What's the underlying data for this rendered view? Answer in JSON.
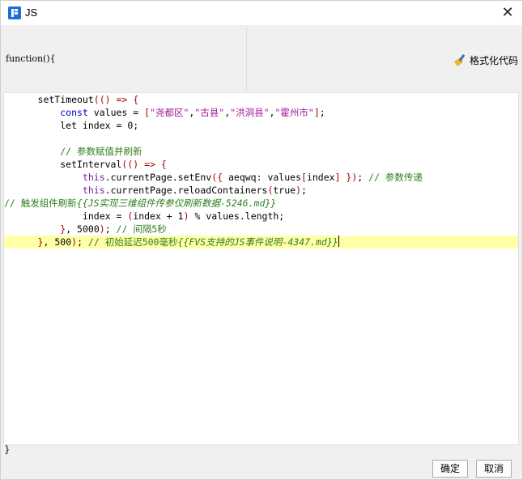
{
  "window": {
    "title": "JS",
    "close_glyph": "✕",
    "icon": "app-logo-icon"
  },
  "signature": {
    "text": "function(){"
  },
  "toolbar": {
    "format_label": "格式化代码",
    "format_icon": "broom-icon"
  },
  "code_lines": [
    {
      "id": "l1",
      "segments": [
        {
          "t": "      setTimeout",
          "c": ""
        },
        {
          "t": "(() => {",
          "c": "op"
        }
      ]
    },
    {
      "id": "l2",
      "segments": [
        {
          "t": "          ",
          "c": ""
        },
        {
          "t": "const",
          "c": "kw2"
        },
        {
          "t": " values = ",
          "c": ""
        },
        {
          "t": "[",
          "c": "op"
        },
        {
          "t": "\"尧都区\"",
          "c": "str"
        },
        {
          "t": ",",
          "c": ""
        },
        {
          "t": "\"古县\"",
          "c": "str"
        },
        {
          "t": ",",
          "c": ""
        },
        {
          "t": "\"洪洞县\"",
          "c": "str"
        },
        {
          "t": ",",
          "c": ""
        },
        {
          "t": "\"霍州市\"",
          "c": "str"
        },
        {
          "t": "]",
          "c": "op"
        },
        {
          "t": ";",
          "c": ""
        }
      ]
    },
    {
      "id": "l3",
      "segments": [
        {
          "t": "          let index = ",
          "c": ""
        },
        {
          "t": "0",
          "c": "num"
        },
        {
          "t": ";",
          "c": ""
        }
      ]
    },
    {
      "id": "l4",
      "segments": [
        {
          "t": "",
          "c": ""
        }
      ]
    },
    {
      "id": "l5",
      "segments": [
        {
          "t": "          ",
          "c": ""
        },
        {
          "t": "// 参数赋值并刷新",
          "c": "cm"
        }
      ]
    },
    {
      "id": "l6",
      "segments": [
        {
          "t": "          setInterval",
          "c": ""
        },
        {
          "t": "(() => {",
          "c": "op"
        }
      ]
    },
    {
      "id": "l7",
      "segments": [
        {
          "t": "              ",
          "c": ""
        },
        {
          "t": "this",
          "c": "kw"
        },
        {
          "t": ".currentPage.setEnv",
          "c": ""
        },
        {
          "t": "({",
          "c": "op"
        },
        {
          "t": " aeqwq: values",
          "c": ""
        },
        {
          "t": "[",
          "c": "op"
        },
        {
          "t": "index",
          "c": ""
        },
        {
          "t": "]",
          "c": "op"
        },
        {
          "t": " })",
          "c": "op"
        },
        {
          "t": "; ",
          "c": ""
        },
        {
          "t": "// 参数传递",
          "c": "cm"
        }
      ]
    },
    {
      "id": "l8",
      "segments": [
        {
          "t": "              ",
          "c": ""
        },
        {
          "t": "this",
          "c": "kw"
        },
        {
          "t": ".currentPage.reloadContainers",
          "c": ""
        },
        {
          "t": "(",
          "c": "op"
        },
        {
          "t": "true",
          "c": ""
        },
        {
          "t": ")",
          "c": "op"
        },
        {
          "t": ";",
          "c": ""
        }
      ]
    },
    {
      "id": "l9",
      "segments": [
        {
          "t": "// 触发组件刷新",
          "c": "cm"
        },
        {
          "t": "{{JS实现三维组件传参仅刷新数据-5246.md}}",
          "c": "cmi"
        }
      ]
    },
    {
      "id": "l10",
      "segments": [
        {
          "t": "              index = ",
          "c": ""
        },
        {
          "t": "(",
          "c": "op"
        },
        {
          "t": "index + ",
          "c": ""
        },
        {
          "t": "1",
          "c": "num"
        },
        {
          "t": ")",
          "c": "op"
        },
        {
          "t": " % values.length;",
          "c": ""
        }
      ]
    },
    {
      "id": "l11",
      "segments": [
        {
          "t": "          ",
          "c": ""
        },
        {
          "t": "}",
          "c": "op"
        },
        {
          "t": ", ",
          "c": ""
        },
        {
          "t": "5000",
          "c": "num"
        },
        {
          "t": ")",
          "c": "op"
        },
        {
          "t": "; ",
          "c": ""
        },
        {
          "t": "// 间隔5秒",
          "c": "cm"
        }
      ]
    },
    {
      "id": "l12",
      "highlight": true,
      "segments": [
        {
          "t": "      ",
          "c": ""
        },
        {
          "t": "}",
          "c": "op"
        },
        {
          "t": ", ",
          "c": ""
        },
        {
          "t": "500",
          "c": "num"
        },
        {
          "t": ")",
          "c": "op"
        },
        {
          "t": "; ",
          "c": ""
        },
        {
          "t": "// 初始延迟500毫秒",
          "c": "cm"
        },
        {
          "t": "{{FVS支持的JS事件说明-4347.md}}",
          "c": "cmi"
        }
      ]
    }
  ],
  "footer": {
    "closing_brace": "}",
    "ok_label": "确定",
    "cancel_label": "取消"
  }
}
